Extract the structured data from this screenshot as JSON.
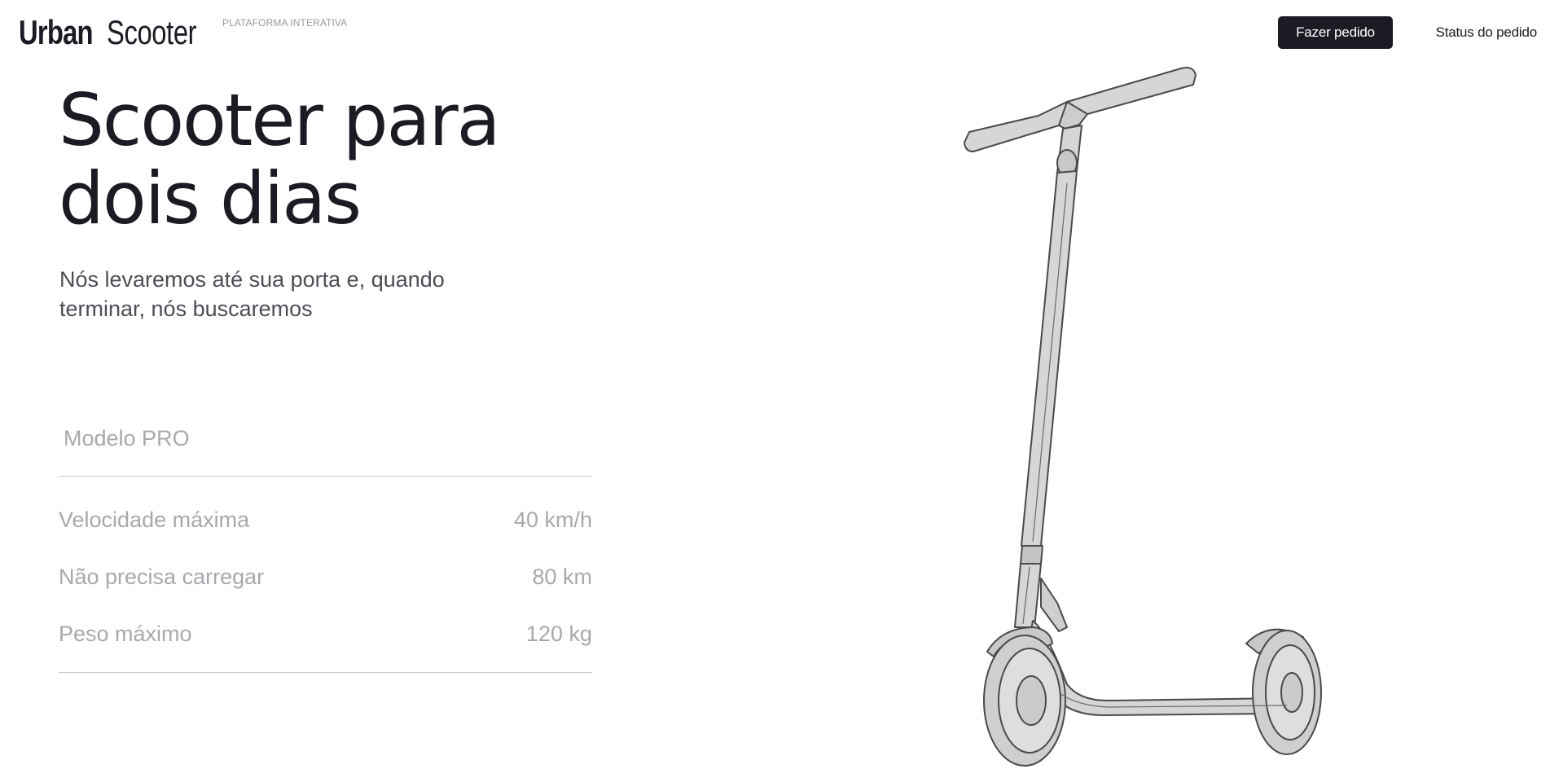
{
  "header": {
    "brand_primary": "Urban",
    "brand_secondary": "Scooter",
    "brand_tag": "PLATAFORMA INTERATIVA",
    "order_button_label": "Fazer pedido",
    "status_button_label": "Status do pedido"
  },
  "hero": {
    "title_line1": "Scooter para",
    "title_line2": "dois dias",
    "subtitle_line1": "Nós levaremos até sua porta e, quando",
    "subtitle_line2": "terminar, nós buscaremos"
  },
  "specs": {
    "model": "Modelo PRO",
    "rows": [
      {
        "label": "Velocidade máxima",
        "value": "40 km/h"
      },
      {
        "label": "Não precisa carregar",
        "value": "80 km"
      },
      {
        "label": "Peso máximo",
        "value": "120 kg"
      }
    ]
  },
  "colors": {
    "accent": "#1b1b24",
    "muted_text": "#a8a8ae",
    "scooter_fill": "#d6d6d6",
    "scooter_stroke": "#4a4a4a"
  },
  "illustration": {
    "icon": "scooter-illustration"
  }
}
